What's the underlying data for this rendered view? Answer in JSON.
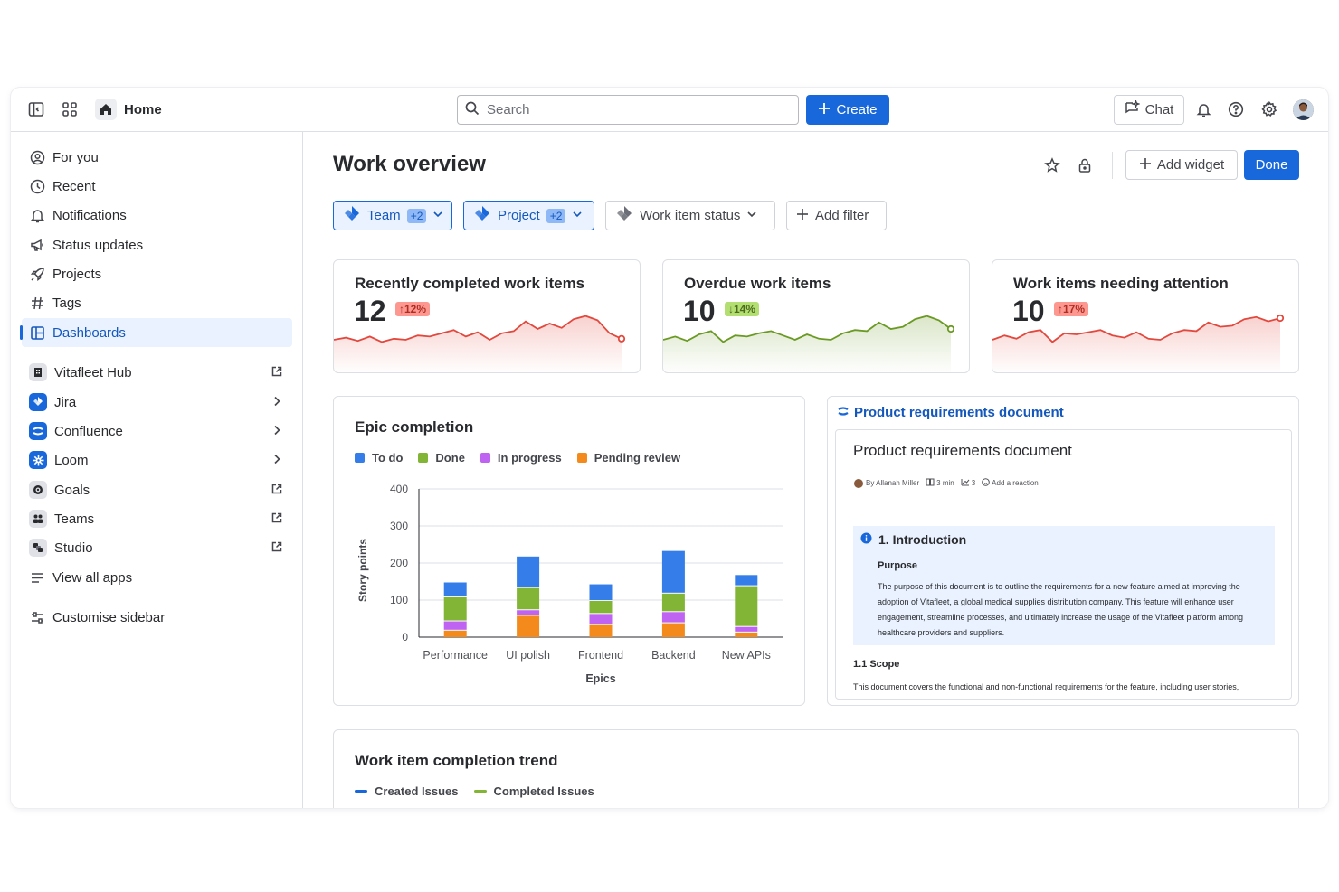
{
  "topbar": {
    "home_label": "Home",
    "search_placeholder": "Search",
    "create_label": "Create",
    "chat_label": "Chat",
    "icons": [
      "sidebar-toggle-icon",
      "app-switcher-icon",
      "home-icon",
      "search-icon",
      "plus-icon",
      "chat-sparkle-icon",
      "bell-icon",
      "help-icon",
      "gear-icon"
    ]
  },
  "sidebar": {
    "items": [
      {
        "label": "For you",
        "icon": "person-circle-icon"
      },
      {
        "label": "Recent",
        "icon": "clock-icon"
      },
      {
        "label": "Notifications",
        "icon": "bell-icon"
      },
      {
        "label": "Status updates",
        "icon": "megaphone-icon"
      },
      {
        "label": "Projects",
        "icon": "rocket-icon"
      },
      {
        "label": "Tags",
        "icon": "hash-icon"
      },
      {
        "label": "Dashboards",
        "icon": "dashboard-icon",
        "active": true
      }
    ],
    "apps": [
      {
        "label": "Vitafleet Hub",
        "trail": "external-link-icon"
      },
      {
        "label": "Jira",
        "trail": "chevron-right-icon"
      },
      {
        "label": "Confluence",
        "trail": "chevron-right-icon"
      },
      {
        "label": "Loom",
        "trail": "chevron-right-icon"
      },
      {
        "label": "Goals",
        "trail": "external-link-icon"
      },
      {
        "label": "Teams",
        "trail": "external-link-icon"
      },
      {
        "label": "Studio",
        "trail": "external-link-icon"
      },
      {
        "label": "View all apps",
        "trail": ""
      }
    ],
    "customise_label": "Customise sidebar"
  },
  "main": {
    "title": "Work overview",
    "add_widget_label": "Add widget",
    "done_label": "Done",
    "filters": [
      {
        "label": "Team",
        "count": "+2",
        "selected": true
      },
      {
        "label": "Project",
        "count": "+2",
        "selected": true
      },
      {
        "label": "Work item status",
        "count": "",
        "selected": false
      }
    ],
    "add_filter_label": "Add filter"
  },
  "stats": [
    {
      "title": "Recently completed work items",
      "value": "12",
      "delta": "↑12%",
      "tone": "red",
      "color": "#e2483d",
      "series": [
        40,
        44,
        38,
        46,
        36,
        42,
        40,
        48,
        46,
        52,
        58,
        46,
        54,
        40,
        52,
        56,
        74,
        60,
        70,
        62,
        78,
        84,
        76,
        52,
        42
      ]
    },
    {
      "title": "Overdue work items",
      "value": "10",
      "delta": "↓14%",
      "tone": "green",
      "color": "#6a9a23",
      "series": [
        40,
        46,
        38,
        50,
        56,
        36,
        48,
        46,
        52,
        56,
        48,
        40,
        50,
        42,
        40,
        52,
        58,
        56,
        72,
        60,
        64,
        78,
        84,
        76,
        60
      ]
    },
    {
      "title": "Work items needing attention",
      "value": "10",
      "delta": "↑17%",
      "tone": "red",
      "color": "#e2483d",
      "series": [
        40,
        48,
        42,
        54,
        58,
        36,
        52,
        50,
        54,
        58,
        48,
        44,
        54,
        42,
        40,
        52,
        58,
        56,
        72,
        64,
        66,
        78,
        82,
        74,
        80
      ]
    }
  ],
  "epic_chart": {
    "title": "Epic completion",
    "legend": [
      {
        "name": "To do",
        "color": "#357de8"
      },
      {
        "name": "Done",
        "color": "#82b536"
      },
      {
        "name": "In progress",
        "color": "#bf63f3"
      },
      {
        "name": "Pending review",
        "color": "#f38a1b"
      }
    ]
  },
  "chart_data": {
    "type": "bar",
    "stacked": true,
    "categories": [
      "Performance",
      "UI polish",
      "Frontend",
      "Backend",
      "New APIs"
    ],
    "series": [
      {
        "name": "Pending review",
        "values": [
          20,
          60,
          35,
          40,
          15
        ]
      },
      {
        "name": "In progress",
        "values": [
          25,
          15,
          30,
          30,
          15
        ]
      },
      {
        "name": "Done",
        "values": [
          65,
          60,
          35,
          50,
          110
        ]
      },
      {
        "name": "To do",
        "values": [
          40,
          85,
          45,
          115,
          30
        ]
      }
    ],
    "xlabel": "Epics",
    "ylabel": "Story points",
    "ylim": [
      0,
      400
    ],
    "yticks": [
      "0",
      "100",
      "200",
      "300",
      "400"
    ],
    "grid": true,
    "legend_position": "top-left"
  },
  "doc": {
    "link_label": "Product requirements document",
    "heading": "Product requirements document",
    "meta_author": "By Allanah Miller",
    "meta_read": "3 min",
    "meta_views": "3",
    "meta_reaction": "Add a reaction",
    "panel_heading": "1. Introduction",
    "panel_sub": "Purpose",
    "panel_text": "The purpose of this document is to outline the requirements for a new feature aimed at improving the adoption of Vitafleet, a global medical supplies distribution company. This feature will enhance user engagement, streamline processes, and ultimately increase the usage of the Vitafleet platform among healthcare providers and suppliers.",
    "section": "1.1 Scope",
    "section_text": "This document covers the functional and non-functional requirements for the feature, including user stories, acceptance criteria, and design considerations."
  },
  "trend": {
    "title": "Work item completion trend",
    "legend": [
      {
        "name": "Created Issues",
        "color": "#1868db"
      },
      {
        "name": "Completed Issues",
        "color": "#82b536"
      }
    ]
  }
}
